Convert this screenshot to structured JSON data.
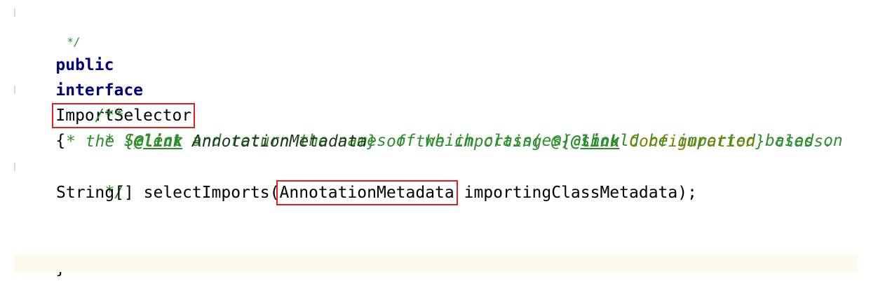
{
  "code": {
    "line0": {
      "text": "*/"
    },
    "line1": {
      "kw1": "public",
      "kw2": "interface",
      "name": "ImportSelector",
      "brace": "{"
    },
    "line3": {
      "text": "/**"
    },
    "line4": {
      "text": "* Select and return the names of which class(es) should be imported based on"
    },
    "line5": {
      "p1": "* the {",
      "tag1": "@link",
      "ref1": " AnnotationMetadata",
      "p2": "} of the importing @{",
      "tag2": "@link",
      "ref2": " Configuration",
      "p3": "} class."
    },
    "line6": {
      "text": "*/"
    },
    "line7": {
      "ret": "String[] selectImports(",
      "param_type": "AnnotationMetadata",
      "rest": " importingClassMetadata);"
    },
    "line9": {
      "text": "}"
    }
  },
  "colors": {
    "keyword": "#000080",
    "comment": "#2f8f2f",
    "highlight_box": "#e02020",
    "current_line": "#fdfaeb"
  }
}
